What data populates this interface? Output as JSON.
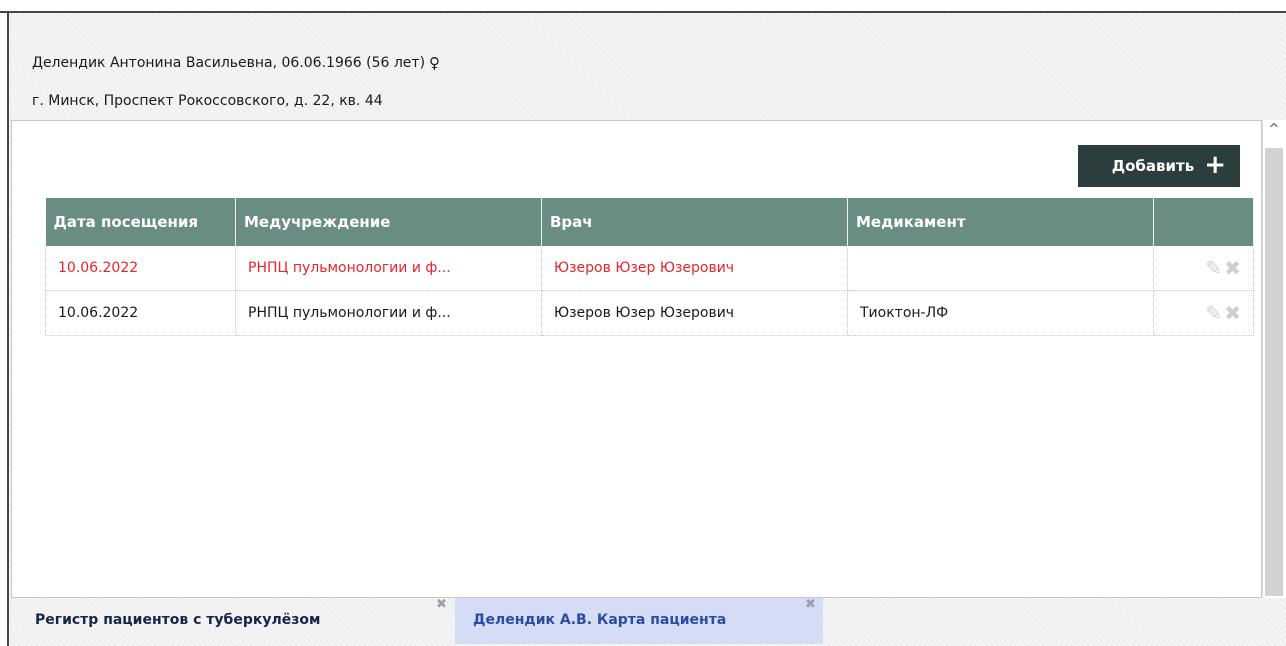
{
  "patient": {
    "name_line": "Делендик Антонина Васильевна, 06.06.1966 (56 лет)",
    "gender_icon": "female-icon",
    "address": "г. Минск, Проспект Рокоссовского, д. 22, кв. 44"
  },
  "toolbar": {
    "add_label": "Добавить",
    "add_icon": "plus-icon"
  },
  "table": {
    "headers": [
      "Дата посещения",
      "Медучреждение",
      "Врач",
      "Медикамент",
      ""
    ],
    "rows": [
      {
        "date": "10.06.2022",
        "facility": "РНПЦ пульмонологии и ф...",
        "doctor": "Юзеров Юзер Юзерович",
        "medicine": "",
        "highlighted": true
      },
      {
        "date": "10.06.2022",
        "facility": "РНПЦ пульмонологии и ф...",
        "doctor": "Юзеров Юзер Юзерович",
        "medicine": "Тиоктон-ЛФ",
        "highlighted": false
      }
    ],
    "row_actions": [
      "edit-icon",
      "delete-icon"
    ]
  },
  "tabs": [
    {
      "label": "Регистр пациентов с туберкулёзом",
      "active": false
    },
    {
      "label": "Делендик А.В. Карта пациента",
      "active": true
    }
  ],
  "colors": {
    "header_bg": "#6a8d83",
    "button_bg": "#2c3d3d",
    "highlight_text": "#e8242c",
    "active_tab_bg": "#d4dcf6"
  }
}
